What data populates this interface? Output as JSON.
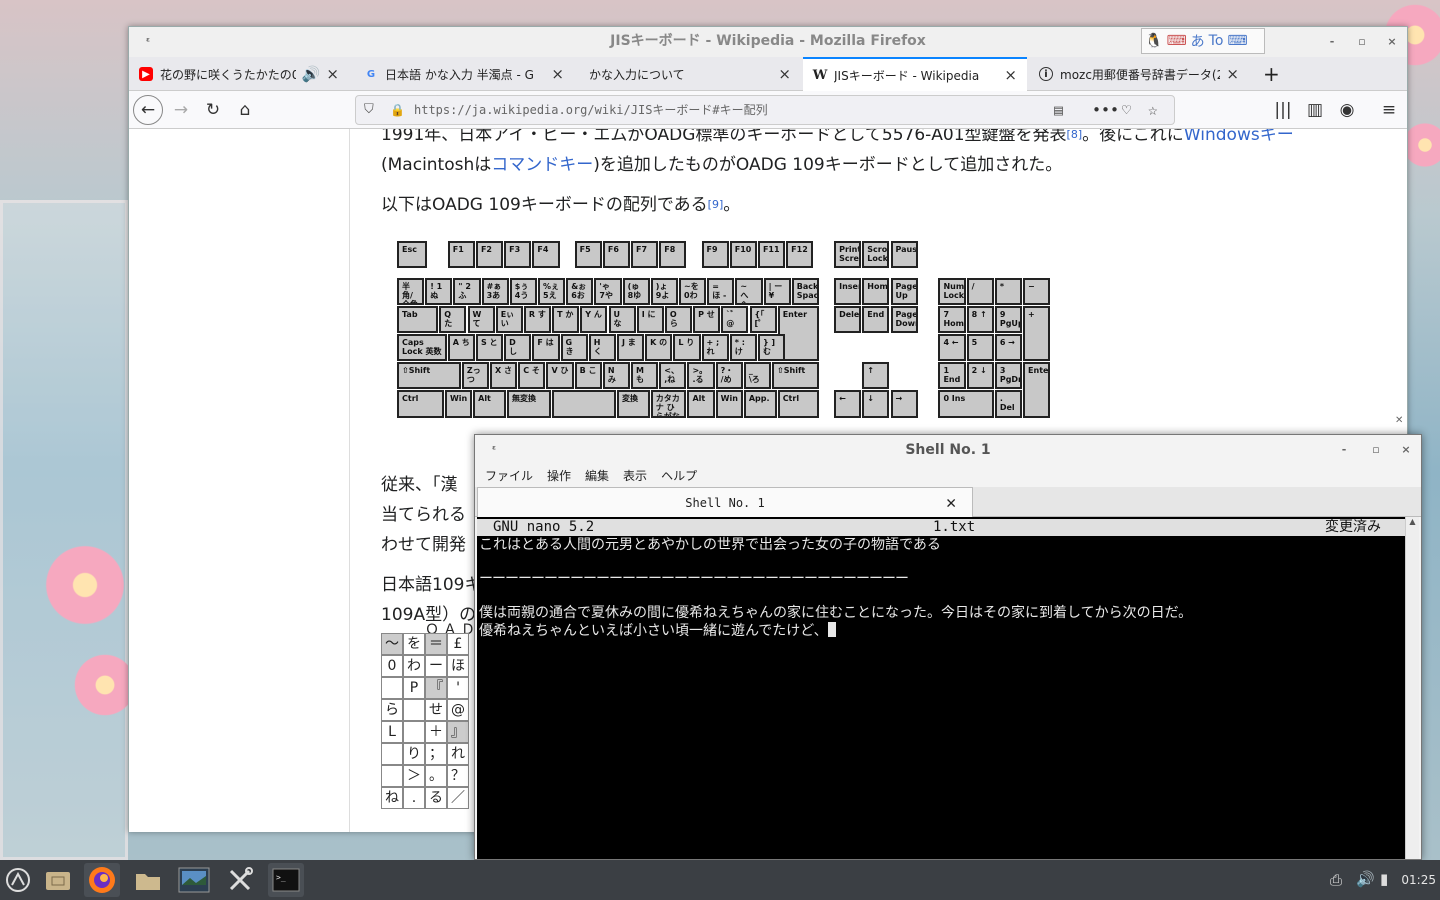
{
  "firefox": {
    "title": "JISキーボード - Wikipedia - Mozilla Firefox",
    "tabs": [
      {
        "label": "花の野に咲くうたかたの0P"
      },
      {
        "label": "日本語 かな入力 半濁点 - G"
      },
      {
        "label": "かな入力について"
      },
      {
        "label": "JISキーボード - Wikipedia"
      },
      {
        "label": "mozc用郵便番号辞書データ(20"
      }
    ],
    "url": "https://ja.wikipedia.org/wiki/JISキーボード#キー配列",
    "ime": {
      "hiragana": "あ",
      "to": "To"
    }
  },
  "article": {
    "p1_line1_a": "1991年、日本アイ・ビー・エムがOADG標準のキーボードとして5576-A01型鍵盤を発表",
    "p1_line1_sup": "[8]",
    "p1_line1_b": "。後にこれに",
    "p1_line1_link": "Windowsキー",
    "p1_line2_a": "(Macintoshは",
    "p1_line2_link": "コマンドキー",
    "p1_line2_b": ")を追加したものがOADG 109キーボードとして追加された。",
    "p2_a": "以下はOADG 109キーボードの配列である",
    "p2_sup": "[9]",
    "p2_b": "。",
    "p3_line1": "従来、「漢",
    "p3_line2": "当てられる",
    "p3_line3": "わせて開発",
    "p4_line1": "日本語109キ",
    "p4_line2": "109A型）の",
    "table_caption": "ＯＡＤ"
  },
  "keyboard_rows": [
    [
      "Esc",
      "F1",
      "F2",
      "F3",
      "F4",
      "F5",
      "F6",
      "F7",
      "F8",
      "F9",
      "F10",
      "F11",
      "F12",
      "Print Screen",
      "Scroll Lock",
      "Pause"
    ],
    [
      "半角/全角",
      "! 1ぬ",
      "\" 2ふ",
      "#ぁ 3あ",
      "$ぅ 4う",
      "%ぇ 5え",
      "&ぉ 6お",
      "'ゃ 7や",
      "(ゅ 8ゆ",
      ")ょ 9よ",
      "~を 0わ",
      "= ほ -",
      "~ へ ^",
      "| ー ¥",
      "Back Space",
      "Insert",
      "Home",
      "Page Up",
      "Num Lock",
      "/",
      "*",
      "−"
    ],
    [
      "Tab",
      "Q た",
      "W て",
      "Eぃ い",
      "R す",
      "T か",
      "Y ん",
      "U な",
      "I に",
      "O ら",
      "P せ",
      "`゛ @",
      "{「 [゜",
      "Enter",
      "Delete",
      "End",
      "Page Down",
      "7 Home",
      "8 ↑",
      "9 PgUp",
      "+"
    ],
    [
      "Caps Lock 英数",
      "A ち",
      "S と",
      "D し",
      "F は",
      "G き",
      "H く",
      "J ま",
      "K の",
      "L り",
      "+ ;れ",
      "* :け",
      "} ]む",
      "4 ←",
      "5",
      "6 →"
    ],
    [
      "⇧Shift",
      "Zっ つ",
      "X さ",
      "C そ",
      "V ひ",
      "B こ",
      "N み",
      "M も",
      "<、 ,ね",
      ">。 .る",
      "?・ /め",
      "_ \\ろ",
      "⇧Shift",
      "↑",
      "1 End",
      "2 ↓",
      "3 PgDn",
      "Enter"
    ],
    [
      "Ctrl",
      "Win",
      "Alt",
      "無変換",
      "",
      "変換",
      "カタカナ ひらがな",
      "Alt",
      "Win",
      "App.",
      "Ctrl",
      "←",
      "↓",
      "→",
      "0 Ins",
      ". Del"
    ]
  ],
  "kana_table": [
    [
      "〜",
      "を",
      "＝",
      "£"
    ],
    [
      "0",
      "わ",
      "ー",
      "ほ"
    ],
    [
      "",
      "P",
      "『",
      "'"
    ],
    [
      "ら",
      "",
      "せ",
      "@"
    ],
    [
      "L",
      "",
      "＋",
      "』"
    ],
    [
      "",
      "り",
      "；",
      "れ"
    ],
    [
      "",
      "＞",
      "。",
      "？"
    ],
    [
      "ね",
      ".",
      "る",
      "／"
    ]
  ],
  "terminal": {
    "title": "Shell No. 1",
    "menu": [
      "ファイル",
      "操作",
      "編集",
      "表示",
      "ヘルプ"
    ],
    "tab": "Shell No. 1",
    "nano_version": "GNU nano 5.2",
    "filename": "1.txt",
    "status": "変更済み",
    "lines": [
      "これはとある人間の元男とあやかしの世界で出会った女の子の物語である",
      "",
      "ーーーーーーーーーーーーーーーーーーーーーーーーーーーーーーーーー",
      "",
      "僕は両親の通合で夏休みの間に優希ねえちゃんの家に住むことになった。今日はその家に到着してから次の日だ。",
      "優希ねえちゃんといえば小さい頃一緒に遊んでたけど、"
    ]
  },
  "taskbar": {
    "clock": "01:25",
    "icons": [
      "menu-icon",
      "file-manager-icon",
      "firefox-icon",
      "folder-icon",
      "image-viewer-icon",
      "settings-icon",
      "terminal-icon"
    ]
  }
}
